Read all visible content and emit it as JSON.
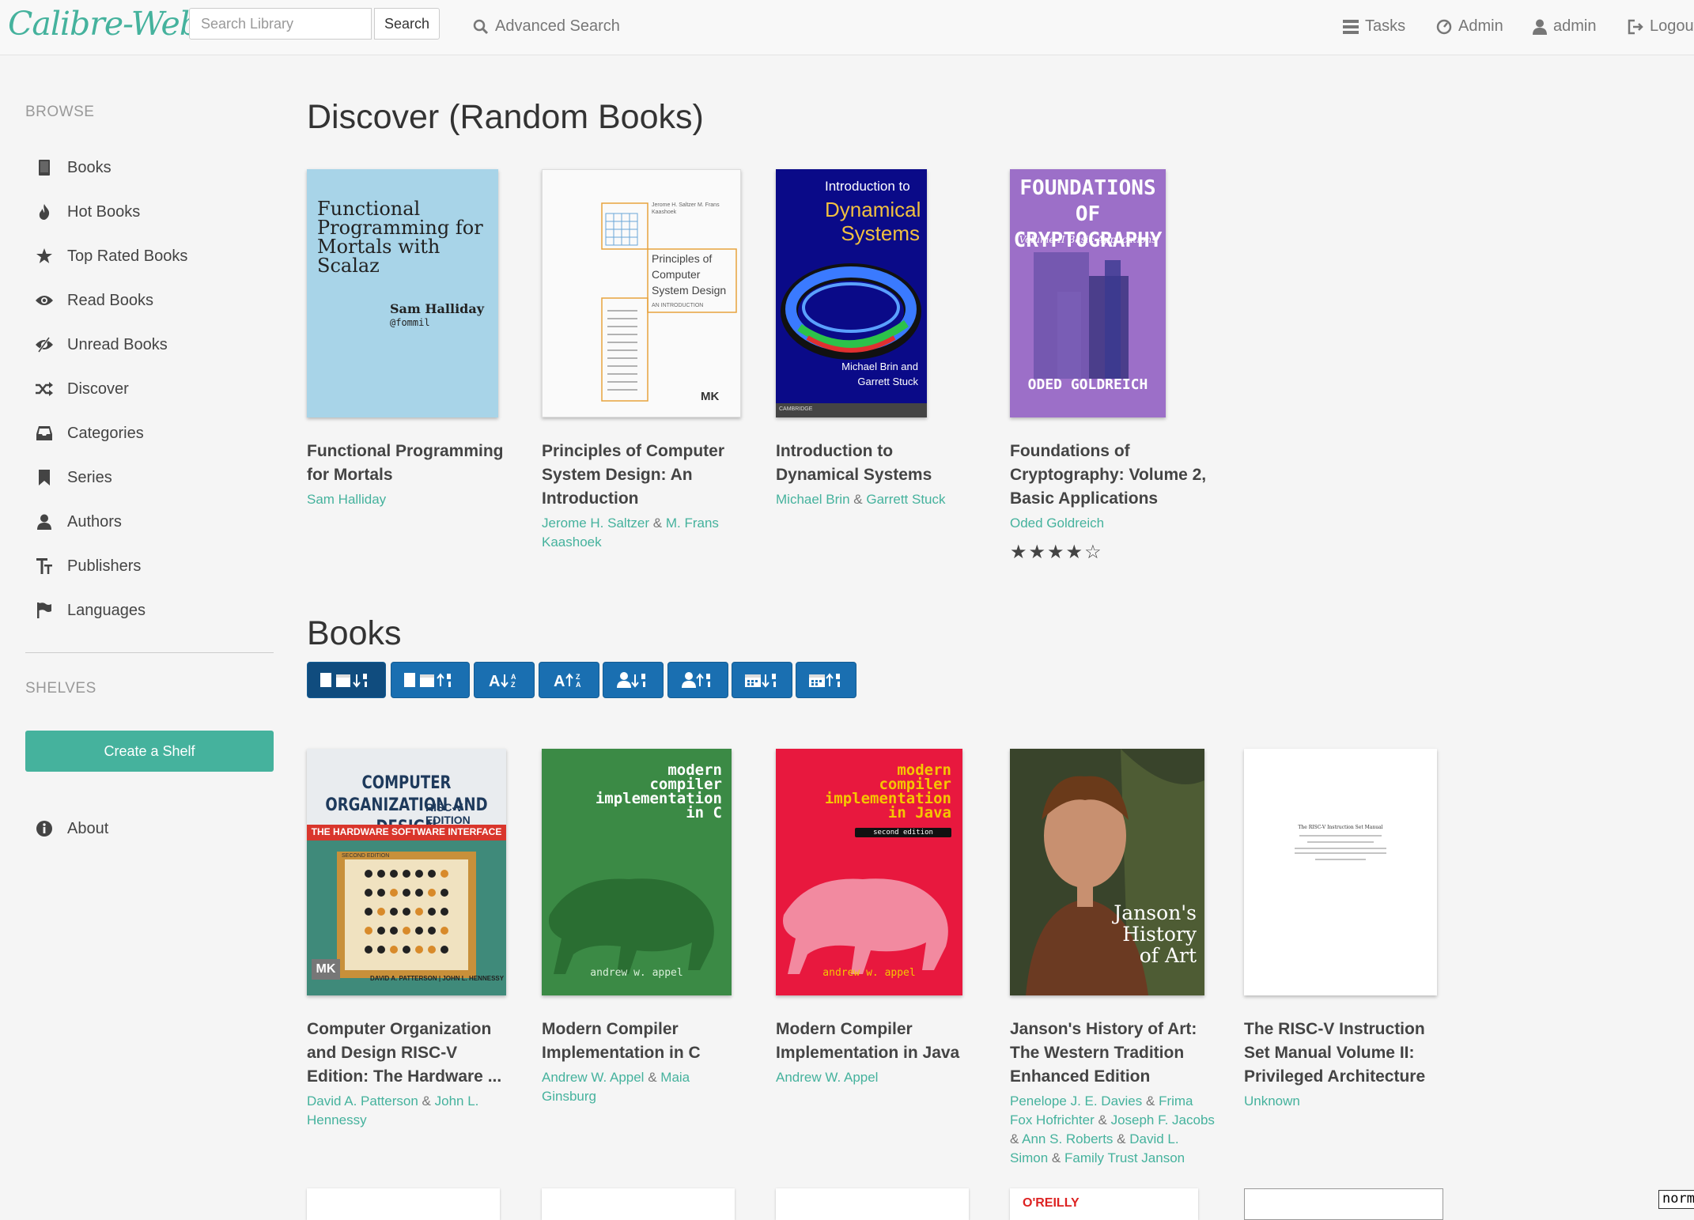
{
  "navbar": {
    "brand": "Calibre-Web",
    "search_placeholder": "Search Library",
    "search_button": "Search",
    "advanced_search": "Advanced Search",
    "tasks": "Tasks",
    "admin": "Admin",
    "user": "admin",
    "logout": "Logout"
  },
  "sidebar": {
    "browse_header": "BROWSE",
    "items": [
      {
        "label": "Books",
        "icon": "book-icon"
      },
      {
        "label": "Hot Books",
        "icon": "fire-icon"
      },
      {
        "label": "Top Rated Books",
        "icon": "star-icon"
      },
      {
        "label": "Read Books",
        "icon": "eye-open-icon"
      },
      {
        "label": "Unread Books",
        "icon": "eye-close-icon"
      },
      {
        "label": "Discover",
        "icon": "random-icon"
      },
      {
        "label": "Categories",
        "icon": "inbox-icon"
      },
      {
        "label": "Series",
        "icon": "bookmark-icon"
      },
      {
        "label": "Authors",
        "icon": "user-icon"
      },
      {
        "label": "Publishers",
        "icon": "text-size-icon"
      },
      {
        "label": "Languages",
        "icon": "flag-icon"
      }
    ],
    "shelves_header": "SHELVES",
    "create_shelf": "Create a Shelf",
    "about": "About"
  },
  "discover": {
    "title": "Discover (Random Books)",
    "books": [
      {
        "title_lines": [
          "Functional Programming",
          "for Mortals"
        ],
        "authors": [
          "Sam Halliday"
        ],
        "cover_title": "Functional Programming for Mortals with Scalaz",
        "cover_author": "Sam Halliday",
        "cover_handle": "@fommil"
      },
      {
        "title_lines": [
          "Principles of Computer",
          "System Design: An",
          "Introduction"
        ],
        "authors": [
          "Jerome H. Saltzer",
          "M. Frans Kaashoek"
        ],
        "cover_title": "Principles of Computer System Design",
        "cover_sub": "AN INTRODUCTION",
        "cover_authors": "Jerome H. Saltzer M. Frans Kaashoek",
        "cover_logo": "MK"
      },
      {
        "title_lines": [
          "Introduction to",
          "Dynamical Systems"
        ],
        "authors": [
          "Michael Brin",
          "Garrett Stuck"
        ],
        "cover_pre": "Introduction to",
        "cover_title": "Dynamical Systems",
        "cover_authors": "Michael Brin and Garrett Stuck",
        "cover_publisher": "CAMBRIDGE"
      },
      {
        "title_lines": [
          "Foundations of",
          "Cryptography: Volume 2,",
          "Basic Applications"
        ],
        "authors": [
          "Oded Goldreich"
        ],
        "cover_title": "FOUNDATIONS OF CRYPTOGRAPHY",
        "cover_sub": "Volume II Basic Applications",
        "cover_author": "ODED GOLDREICH",
        "rating": 4
      }
    ]
  },
  "books_section": {
    "title": "Books",
    "sort_buttons": [
      {
        "name": "sort-date-newest-button"
      },
      {
        "name": "sort-date-oldest-button"
      },
      {
        "name": "sort-title-az-button"
      },
      {
        "name": "sort-title-za-button"
      },
      {
        "name": "sort-author-az-button"
      },
      {
        "name": "sort-author-za-button"
      },
      {
        "name": "sort-pubdate-newest-button"
      },
      {
        "name": "sort-pubdate-oldest-button"
      }
    ],
    "books": [
      {
        "title_lines": [
          "Computer Organization",
          "and Design RISC-V",
          "Edition: The Hardware ..."
        ],
        "authors": [
          "David A. Patterson",
          "John L. Hennessy"
        ],
        "cover_title": "COMPUTER ORGANIZATION AND DESIGN",
        "cover_edition": "RISC-V EDITION",
        "cover_band": "THE HARDWARE SOFTWARE INTERFACE",
        "cover_authors": "DAVID A. PATTERSON | JOHN L. HENNESSY",
        "cover_logo": "MK",
        "cover_second": "SECOND EDITION"
      },
      {
        "title_lines": [
          "Modern Compiler",
          "Implementation in C"
        ],
        "authors": [
          "Andrew W. Appel",
          "Maia Ginsburg"
        ],
        "cover_title_lines": [
          "modern",
          "compiler",
          "implementation",
          "in C"
        ],
        "cover_author": "andrew w. appel"
      },
      {
        "title_lines": [
          "Modern Compiler",
          "Implementation in Java"
        ],
        "authors": [
          "Andrew W. Appel"
        ],
        "cover_title_lines": [
          "modern",
          "compiler",
          "implementation",
          "in Java"
        ],
        "cover_edition": "second edition",
        "cover_author": "andrew w. appel"
      },
      {
        "title_lines": [
          "Janson's History of Art:",
          "The Western Tradition",
          "Enhanced Edition"
        ],
        "authors": [
          "Penelope J. E. Davies",
          "Frima Fox Hofrichter",
          "Joseph F. Jacobs",
          "Ann S. Roberts",
          "David L. Simon",
          "Family Trust Janson"
        ],
        "cover_title_lines": [
          "Janson's",
          "History",
          "of Art"
        ]
      },
      {
        "title_lines": [
          "The RISC-V Instruction",
          "Set Manual Volume II:",
          "Privileged Architecture"
        ],
        "authors": [
          "Unknown"
        ],
        "cover_title": "The RISC-V Instruction Set Manual"
      }
    ],
    "partial_cover_text": "O'REILLY"
  },
  "status_badge": "normal",
  "colors": {
    "accent": "#45b29d",
    "sort_button": "#1a6fb1",
    "sort_button_active": "#104c7e"
  }
}
